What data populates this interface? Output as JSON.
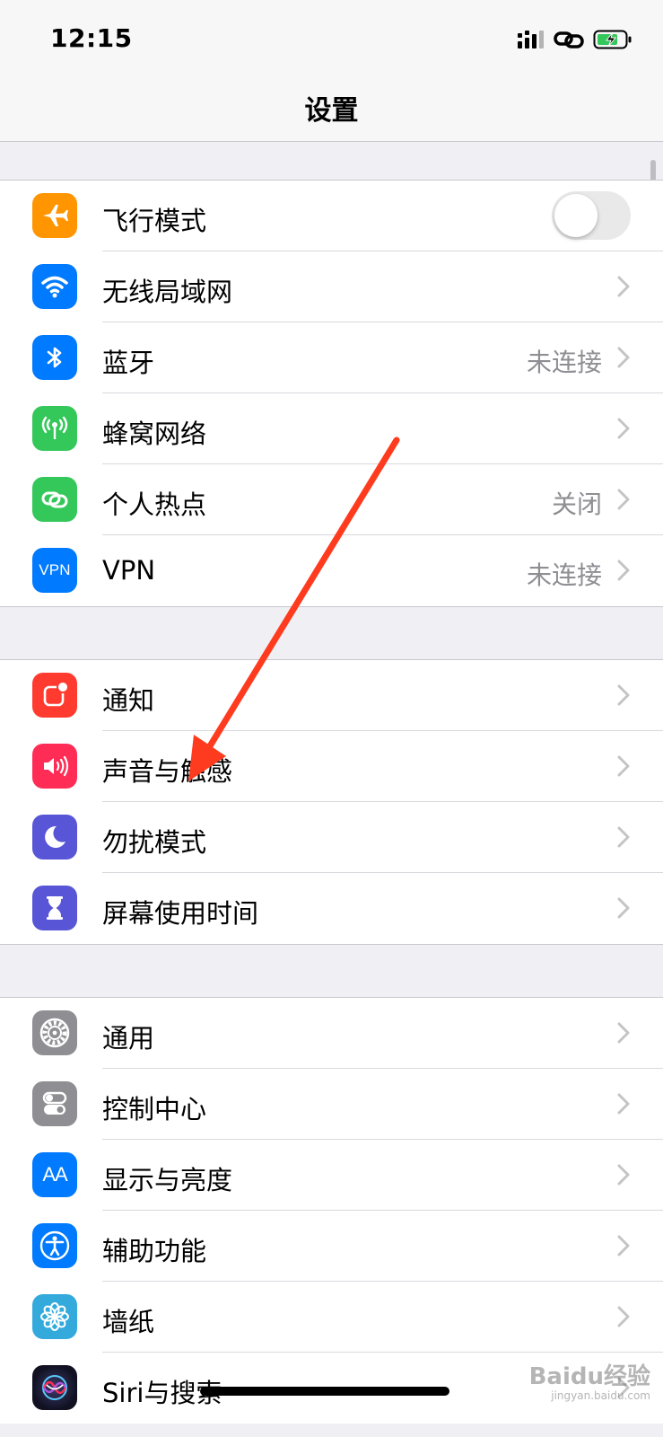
{
  "status_bar": {
    "time": "12:15"
  },
  "nav": {
    "title": "设置"
  },
  "groups": [
    {
      "rows": [
        {
          "label": "飞行模式",
          "icon": "airplane-icon",
          "color": "#ff9500",
          "toggle": false
        },
        {
          "label": "无线局域网",
          "icon": "wifi-icon",
          "color": "#007aff",
          "value": ""
        },
        {
          "label": "蓝牙",
          "icon": "bluetooth-icon",
          "color": "#007aff",
          "value": "未连接"
        },
        {
          "label": "蜂窝网络",
          "icon": "cellular-icon",
          "color": "#34c759",
          "value": ""
        },
        {
          "label": "个人热点",
          "icon": "hotspot-icon",
          "color": "#34c759",
          "value": "关闭"
        },
        {
          "label": "VPN",
          "icon": "vpn-icon",
          "icon_text": "VPN",
          "color": "#007aff",
          "value": "未连接"
        }
      ]
    },
    {
      "rows": [
        {
          "label": "通知",
          "icon": "notifications-icon",
          "color": "#ff3b30",
          "value": ""
        },
        {
          "label": "声音与触感",
          "icon": "sounds-icon",
          "color": "#ff2d55",
          "value": ""
        },
        {
          "label": "勿扰模式",
          "icon": "moon-icon",
          "color": "#5856d6",
          "value": ""
        },
        {
          "label": "屏幕使用时间",
          "icon": "hourglass-icon",
          "color": "#5856d6",
          "value": ""
        }
      ]
    },
    {
      "rows": [
        {
          "label": "通用",
          "icon": "gear-icon",
          "color": "#8e8e93",
          "value": ""
        },
        {
          "label": "控制中心",
          "icon": "control-center-icon",
          "color": "#8e8e93",
          "value": ""
        },
        {
          "label": "显示与亮度",
          "icon": "display-icon",
          "icon_text": "AA",
          "color": "#007aff",
          "value": ""
        },
        {
          "label": "辅助功能",
          "icon": "accessibility-icon",
          "color": "#007aff",
          "value": ""
        },
        {
          "label": "墙纸",
          "icon": "wallpaper-icon",
          "color": "#34aadc",
          "value": ""
        },
        {
          "label": "Siri与搜索",
          "icon": "siri-icon",
          "color": "#1c1c3c",
          "value": ""
        }
      ]
    }
  ],
  "watermark": {
    "brand": "Baidu经验",
    "url": "jingyan.baidu.com"
  },
  "colors": {
    "annotation_arrow": "#ff3b1f",
    "chevron": "#c4c4c7",
    "background": "#efeff4"
  }
}
